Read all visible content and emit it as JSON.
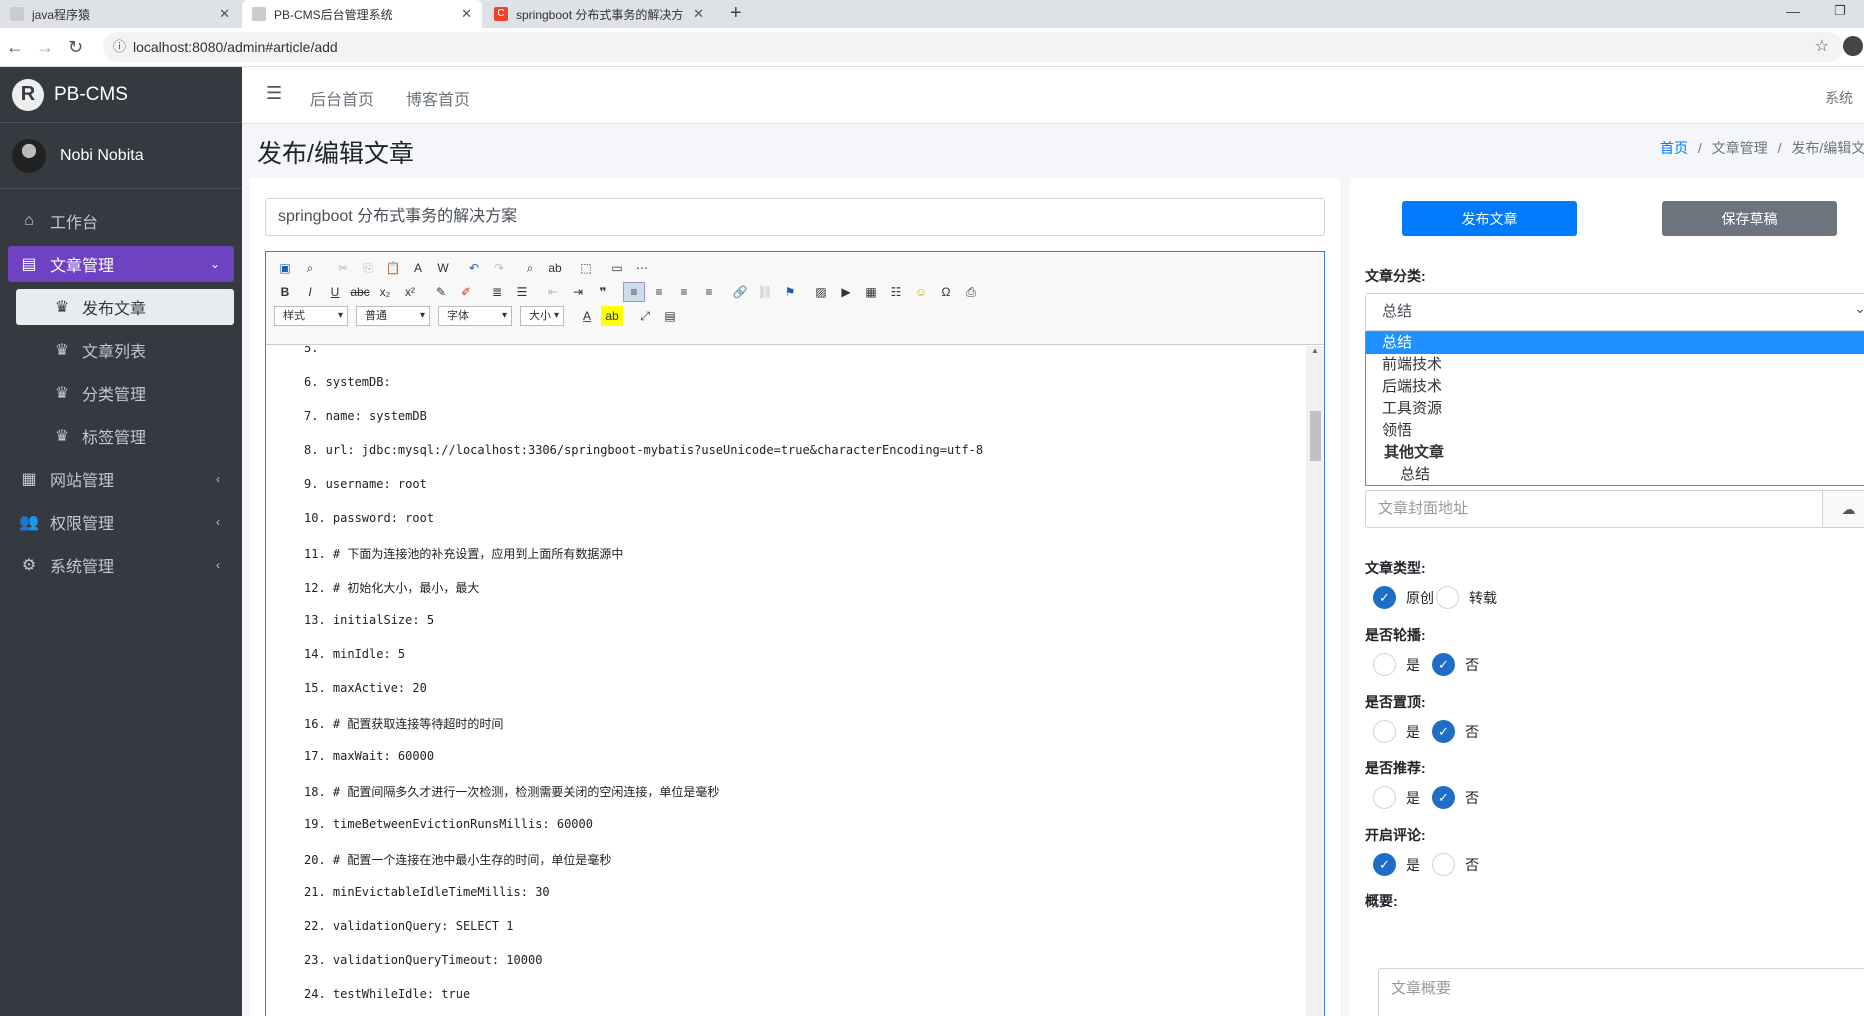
{
  "browser": {
    "tabs": [
      {
        "label": "java程序猿",
        "icon": "page-icon",
        "active": false
      },
      {
        "label": "PB-CMS后台管理系统",
        "icon": "page-icon",
        "active": true
      },
      {
        "label": "springboot 分布式事务的解决方",
        "icon": "csdn-icon",
        "active": false
      }
    ],
    "url": "localhost:8080/admin#article/add"
  },
  "sidebar": {
    "brand": "PB-CMS",
    "brand_logo": "R",
    "user": "Nobi Nobita",
    "items": [
      {
        "label": "工作台",
        "icon": "home-icon"
      },
      {
        "label": "文章管理",
        "icon": "list-icon",
        "active": true
      },
      {
        "label": "网站管理",
        "icon": "table-icon"
      },
      {
        "label": "权限管理",
        "icon": "users-icon"
      },
      {
        "label": "系统管理",
        "icon": "gear-icon"
      }
    ],
    "sub_items": [
      {
        "label": "发布文章",
        "active": true
      },
      {
        "label": "文章列表"
      },
      {
        "label": "分类管理"
      },
      {
        "label": "标签管理"
      }
    ]
  },
  "topnav": {
    "home": "后台首页",
    "blog": "博客首页",
    "system": "系统"
  },
  "page": {
    "title": "发布/编辑文章",
    "breadcrumb": [
      "首页",
      "文章管理",
      "发布/编辑文"
    ]
  },
  "editor": {
    "title_value": "springboot 分布式事务的解决方案",
    "toolbar_selects": [
      "样式",
      "普通",
      "字体",
      "大小"
    ],
    "lines": [
      "5.",
      "6. systemDB:",
      "7. name: systemDB",
      "8. url: jdbc:mysql://localhost:3306/springboot-mybatis?useUnicode=true&characterEncoding=utf-8",
      "9. username: root",
      "10. password: root",
      "11. # 下面为连接池的补充设置，应用到上面所有数据源中",
      "12. # 初始化大小，最小，最大",
      "13. initialSize: 5",
      "14. minIdle: 5",
      "15. maxActive: 20",
      "16. # 配置获取连接等待超时的时间",
      "17. maxWait: 60000",
      "18. # 配置间隔多久才进行一次检测，检测需要关闭的空闲连接，单位是毫秒",
      "19. timeBetweenEvictionRunsMillis: 60000",
      "20. # 配置一个连接在池中最小生存的时间，单位是毫秒",
      "21. minEvictableIdleTimeMillis: 30",
      "22. validationQuery: SELECT 1",
      "23. validationQueryTimeout: 10000",
      "24. testWhileIdle: true"
    ]
  },
  "panel": {
    "publish": "发布文章",
    "draft": "保存草稿",
    "category_label": "文章分类:",
    "category_value": "总结",
    "category_options": [
      "总结",
      "前端技术",
      "后端技术",
      "工具资源",
      "领悟"
    ],
    "category_group": "其他文章",
    "category_group_child": "总结",
    "cover_placeholder": "文章封面地址",
    "type_label": "文章类型:",
    "type_options": [
      "原创",
      "转载"
    ],
    "carousel_label": "是否轮播:",
    "top_label": "是否置顶:",
    "recommend_label": "是否推荐:",
    "comment_label": "开启评论:",
    "yes": "是",
    "no": "否",
    "summary_label": "概要:",
    "summary_placeholder": "文章概要"
  },
  "colors": {
    "sidebar_bg": "#343a40",
    "active_menu": "#6f42c1",
    "primary": "#007bff",
    "secondary": "#6c757d",
    "radio_checked": "#1e6ec8"
  }
}
